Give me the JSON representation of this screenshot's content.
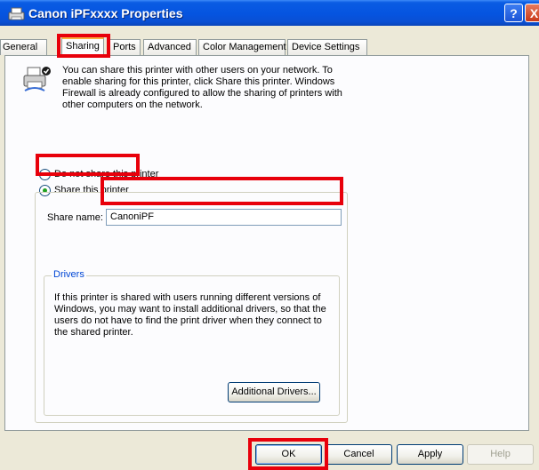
{
  "window": {
    "title": "Canon iPFxxxx Properties",
    "help_button": "?",
    "close_button": "X"
  },
  "tabs": [
    {
      "label": "General"
    },
    {
      "label": "Sharing"
    },
    {
      "label": "Ports"
    },
    {
      "label": "Advanced"
    },
    {
      "label": "Color Management"
    },
    {
      "label": "Device Settings"
    }
  ],
  "sharing": {
    "intro_text": "You can share this printer with other users on your network. To enable sharing for this printer, click Share this printer. Windows Firewall is already configured to allow the sharing of printers with other computers on the network.",
    "option_no_share": "Do not share this printer",
    "option_share": "Share this printer",
    "selected_option": "Share this printer",
    "share_name_label": "Share name:",
    "share_name_value": "CanoniPF"
  },
  "drivers": {
    "legend": "Drivers",
    "text": "If this printer is shared with users running different versions of Windows, you may want to install additional drivers, so that the users do not have to find the print driver when they connect to the shared printer.",
    "additional_drivers_button": "Additional Drivers..."
  },
  "buttons": {
    "ok": "OK",
    "cancel": "Cancel",
    "apply": "Apply",
    "help": "Help"
  },
  "colors": {
    "highlight": "#e8000b",
    "titlebar": "#0554e0",
    "dialog_bg": "#ece9d8",
    "panel_bg": "#fcfcfe",
    "tab_accent": "#f9b03e",
    "group_label": "#0046d5"
  }
}
